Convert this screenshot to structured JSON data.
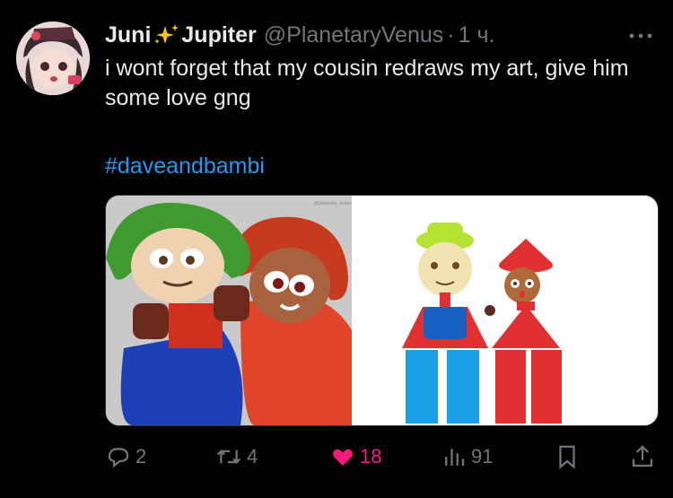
{
  "tweet": {
    "author_name": "Juni",
    "author_name_suffix": "Jupiter",
    "author_emoji_icon": "sparkles-icon",
    "handle": "@PlanetaryVenus",
    "separator": "·",
    "time": "1 ч.",
    "text": "i wont forget that my cousin redraws my art, give him some love gng",
    "hashtag": "#daveandbambi",
    "media": {
      "left_watermark": "@planetary_venus",
      "left_image": "fan-art-dave-and-bambi",
      "right_image": "original-dave-and-bambi"
    }
  },
  "actions": {
    "reply_count": "2",
    "retweet_count": "4",
    "like_count": "18",
    "views_count": "91",
    "like_color": "#f91880",
    "icons": [
      "reply-icon",
      "retweet-icon",
      "heart-icon",
      "views-icon",
      "bookmark-icon",
      "share-icon"
    ]
  },
  "colors": {
    "background": "#000000",
    "text": "#e7e9ea",
    "muted": "#71767b",
    "link": "#1d9bf0"
  }
}
